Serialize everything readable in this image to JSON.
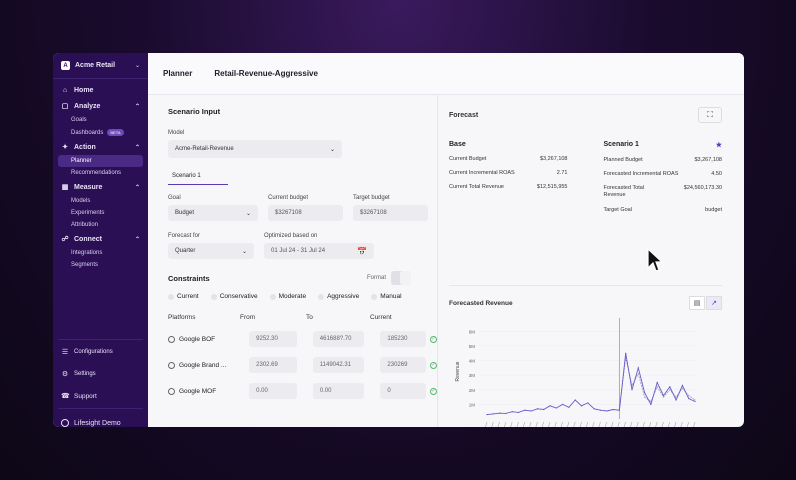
{
  "app": {
    "org": "Acme Retail",
    "page": "Planner",
    "scenario_title": "Retail-Revenue-Aggressive"
  },
  "sidebar": {
    "home": "Home",
    "analyze": "Analyze",
    "goals": "Goals",
    "dashboards": "Dashboards",
    "beta": "BETA",
    "action": "Action",
    "planner": "Planner",
    "recommendations": "Recommendations",
    "measure": "Measure",
    "models": "Models",
    "experiments": "Experiments",
    "attribution": "Attribution",
    "connect": "Connect",
    "integrations": "Integrations",
    "segments": "Segments",
    "configurations": "Configurations",
    "settings": "Settings",
    "support": "Support",
    "user": "Lifesight Demo"
  },
  "scenario_input": {
    "title": "Scenario Input",
    "model_label": "Model",
    "model_value": "Acme-Retail-Revenue",
    "tab": "Scenario 1",
    "goal_label": "Goal",
    "goal_value": "Budget",
    "current_budget_label": "Current budget",
    "current_budget_value": "$3267108",
    "target_budget_label": "Target budget",
    "target_budget_value": "$3267108",
    "forecast_for_label": "Forecast for",
    "forecast_for_value": "Quarter",
    "optimized_label": "Optimized based on",
    "optimized_value": "01 Jul 24 - 31 Jul 24"
  },
  "constraints": {
    "title": "Constraints",
    "format_label": "Format",
    "options": [
      "Current",
      "Conservative",
      "Moderate",
      "Aggressive",
      "Manual"
    ],
    "col_platforms": "Platforms",
    "col_from": "From",
    "col_to": "To",
    "col_current": "Current",
    "rows": [
      {
        "name": "Google BOF",
        "from": "9252.30",
        "to": "461688?.70",
        "current": "185230"
      },
      {
        "name": "Google Brand ...",
        "from": "2302.69",
        "to": "1149042.31",
        "current": "230269"
      },
      {
        "name": "Google MOF",
        "from": "0.00",
        "to": "0.00",
        "current": "0"
      }
    ]
  },
  "forecast": {
    "title": "Forecast",
    "base": {
      "title": "Base",
      "rows": [
        {
          "k": "Current Budget",
          "v": "$3,267,108"
        },
        {
          "k": "Current Incremental ROAS",
          "v": "2.71"
        },
        {
          "k": "Current Total Revenue",
          "v": "$12,515,955"
        }
      ]
    },
    "scenario": {
      "title": "Scenario 1",
      "rows": [
        {
          "k": "Planned Budget",
          "v": "$3,267,108"
        },
        {
          "k": "Forecasted Incremental ROAS",
          "v": "4.50"
        },
        {
          "k": "Forecasted Total Revenue",
          "v": "$24,560,173.30"
        },
        {
          "k": "Target Goal",
          "v": "budget"
        }
      ]
    }
  },
  "chart_data": {
    "type": "line",
    "title": "Forecasted Revenue",
    "ylabel": "Revenue",
    "yticks": [
      "6M",
      "5M",
      "4M",
      "3M",
      "2M",
      "1M"
    ],
    "ylim": [
      0,
      6500000
    ],
    "series": [
      {
        "values": [
          300000,
          350000,
          400000,
          380000,
          500000,
          450000,
          600000,
          550000,
          700000,
          650000,
          900000,
          750000,
          1000000,
          800000,
          1300000,
          900000,
          1100000,
          700000,
          600000,
          550000,
          650000,
          600000,
          4500000,
          2000000,
          3500000,
          1800000,
          1000000,
          2500000,
          1600000,
          2200000,
          1300000,
          2300000,
          1400000,
          1200000
        ]
      },
      {
        "values": [
          null,
          null,
          null,
          null,
          null,
          null,
          null,
          null,
          null,
          null,
          null,
          null,
          null,
          null,
          null,
          null,
          null,
          null,
          null,
          null,
          null,
          700000,
          4200000,
          2300000,
          3100000,
          1500000,
          1200000,
          2200000,
          1500000,
          2000000,
          1500000,
          2100000,
          1600000,
          1300000
        ]
      }
    ],
    "colors": {
      "actual": "#6a5acd",
      "forecast": "#9aa3c8",
      "divider": "#f08a24"
    }
  }
}
